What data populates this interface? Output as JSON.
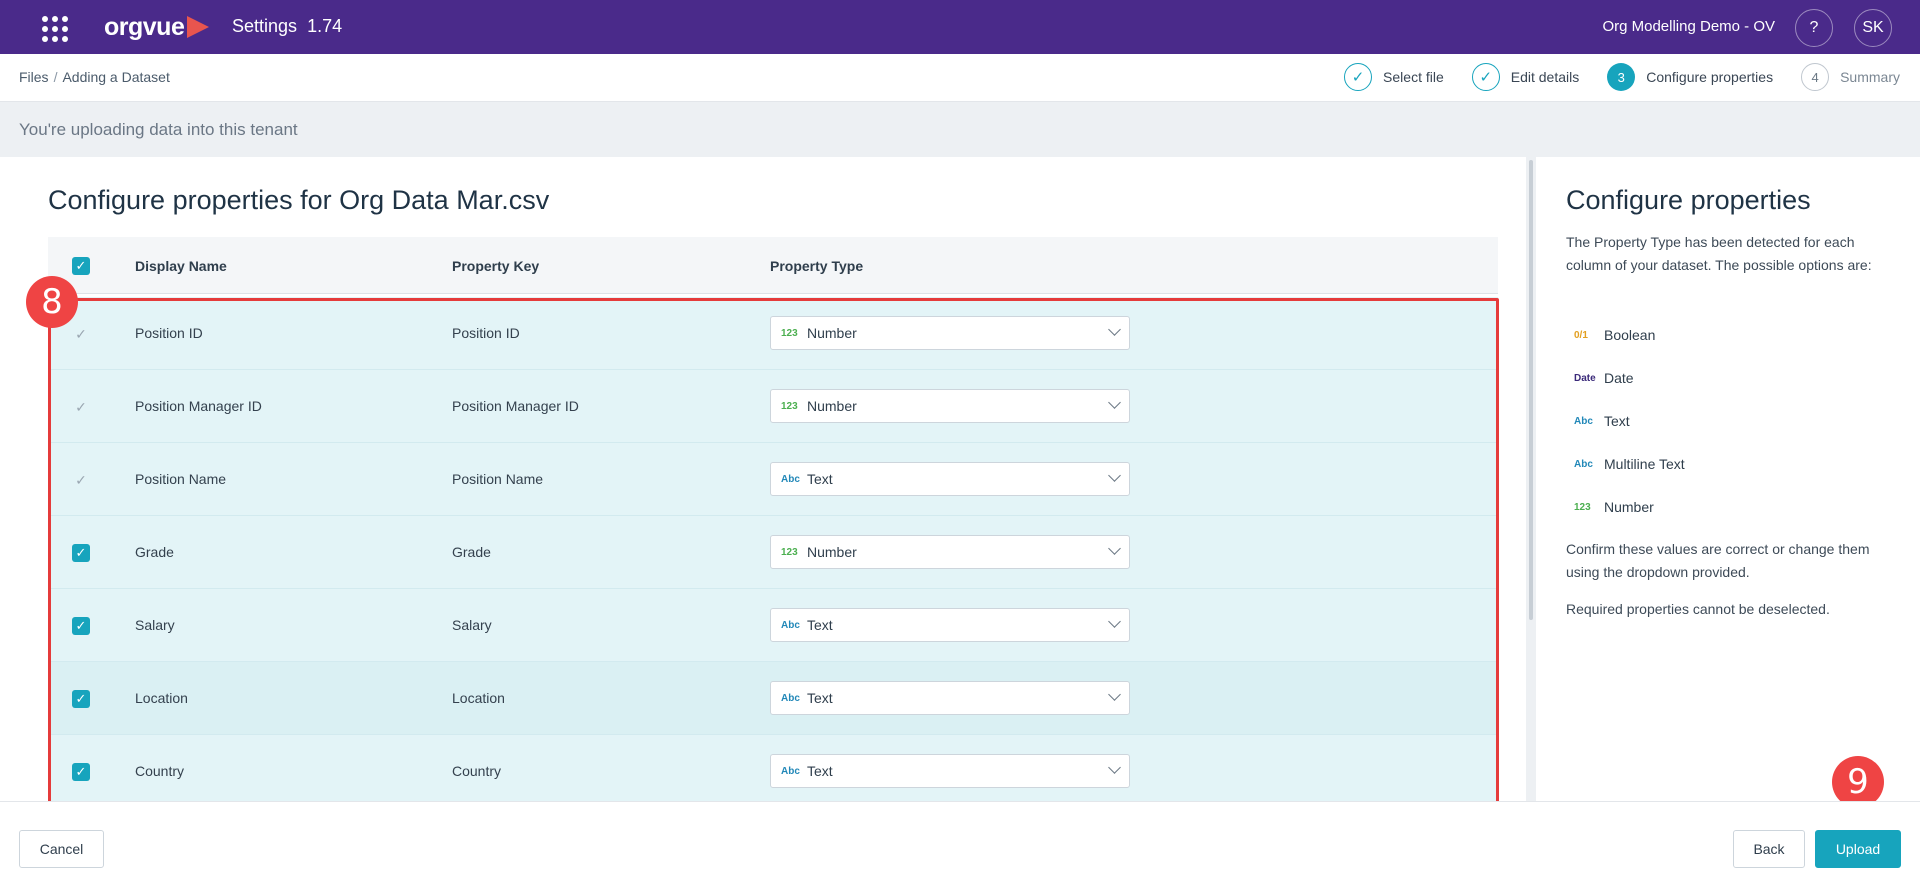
{
  "header": {
    "logo_text": "orgvue",
    "app_title": "Settings",
    "version": "1.74",
    "tenant_name": "Org Modelling Demo - OV",
    "help_label": "?",
    "user_initials": "SK",
    "brand_color": "#4a2a8a"
  },
  "breadcrumb": {
    "root": "Files",
    "separator": "/",
    "current": "Adding a Dataset"
  },
  "steps": [
    {
      "number": "✓",
      "label": "Select file",
      "state": "done"
    },
    {
      "number": "✓",
      "label": "Edit details",
      "state": "done"
    },
    {
      "number": "3",
      "label": "Configure properties",
      "state": "active"
    },
    {
      "number": "4",
      "label": "Summary",
      "state": "todo"
    }
  ],
  "notice": "You're uploading data into this tenant",
  "main": {
    "title": "Configure properties for Org Data Mar.csv",
    "columns": {
      "display_name": "Display Name",
      "property_key": "Property Key",
      "property_type": "Property Type"
    },
    "rows": [
      {
        "display_name": "Position ID",
        "property_key": "Position ID",
        "type_icon": "123",
        "type": "Number",
        "checked": "locked"
      },
      {
        "display_name": "Position Manager ID",
        "property_key": "Position Manager ID",
        "type_icon": "123",
        "type": "Number",
        "checked": "locked"
      },
      {
        "display_name": "Position Name",
        "property_key": "Position Name",
        "type_icon": "Abc",
        "type": "Text",
        "checked": "locked"
      },
      {
        "display_name": "Grade",
        "property_key": "Grade",
        "type_icon": "123",
        "type": "Number",
        "checked": "on"
      },
      {
        "display_name": "Salary",
        "property_key": "Salary",
        "type_icon": "Abc",
        "type": "Text",
        "checked": "on"
      },
      {
        "display_name": "Location",
        "property_key": "Location",
        "type_icon": "Abc",
        "type": "Text",
        "checked": "on"
      },
      {
        "display_name": "Country",
        "property_key": "Country",
        "type_icon": "Abc",
        "type": "Text",
        "checked": "on"
      }
    ]
  },
  "side": {
    "title": "Configure properties",
    "intro": "The Property Type has been detected for each column of your dataset. The possible options are:",
    "types": [
      {
        "icon": "0/1",
        "label": "Boolean"
      },
      {
        "icon": "Date",
        "label": "Date"
      },
      {
        "icon": "Abc",
        "label": "Text"
      },
      {
        "icon": "Abc",
        "label": "Multiline Text"
      },
      {
        "icon": "123",
        "label": "Number"
      }
    ],
    "confirm": "Confirm these values are correct or change them using the dropdown provided.",
    "required": "Required properties cannot be deselected."
  },
  "footer": {
    "cancel": "Cancel",
    "back": "Back",
    "upload": "Upload"
  },
  "annotations": {
    "marker_table": "8",
    "marker_upload": "9"
  },
  "colors": {
    "accent": "#17a4bd",
    "highlight": "#e53b3b"
  }
}
